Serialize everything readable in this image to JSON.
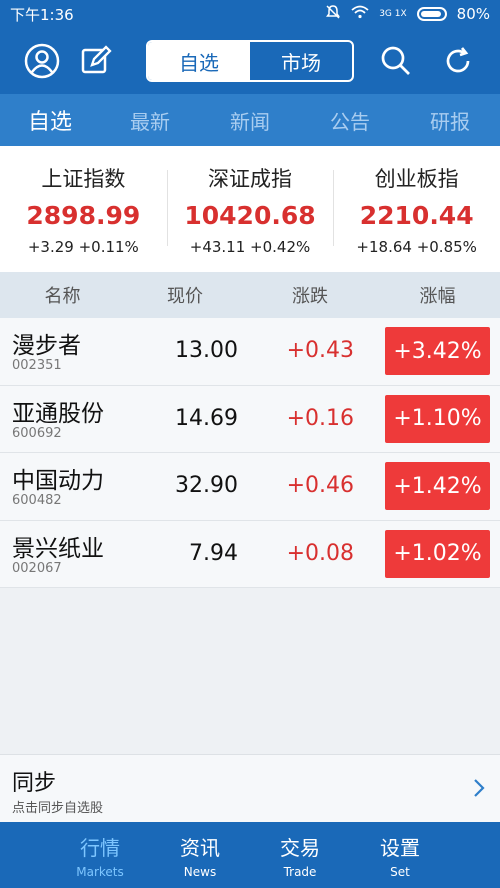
{
  "status_bar": {
    "time": "下午1:36",
    "network": "3G 1X",
    "battery": "80%"
  },
  "app_bar": {
    "segment": [
      "自选",
      "市场"
    ]
  },
  "sub_tabs": [
    "自选",
    "最新",
    "新闻",
    "公告",
    "研报"
  ],
  "indices": [
    {
      "name": "上证指数",
      "value": "2898.99",
      "change": "+3.29 +0.11%"
    },
    {
      "name": "深证成指",
      "value": "10420.68",
      "change": "+43.11 +0.42%"
    },
    {
      "name": "创业板指",
      "value": "2210.44",
      "change": "+18.64 +0.85%"
    }
  ],
  "table": {
    "headers": [
      "名称",
      "现价",
      "涨跌",
      "涨幅"
    ],
    "rows": [
      {
        "name": "漫步者",
        "code": "002351",
        "price": "13.00",
        "change": "+0.43",
        "pct": "+3.42%"
      },
      {
        "name": "亚通股份",
        "code": "600692",
        "price": "14.69",
        "change": "+0.16",
        "pct": "+1.10%"
      },
      {
        "name": "中国动力",
        "code": "600482",
        "price": "32.90",
        "change": "+0.46",
        "pct": "+1.42%"
      },
      {
        "name": "景兴纸业",
        "code": "002067",
        "price": "7.94",
        "change": "+0.08",
        "pct": "+1.02%"
      }
    ]
  },
  "sync": {
    "title": "同步",
    "subtitle": "点击同步自选股"
  },
  "bottom_nav": [
    {
      "zh": "行情",
      "en": "Markets",
      "active": true
    },
    {
      "zh": "资讯",
      "en": "News"
    },
    {
      "zh": "交易",
      "en": "Trade"
    },
    {
      "zh": "设置",
      "en": "Set"
    }
  ],
  "colors": {
    "primary": "#1a69b8",
    "up": "#d8302f",
    "up_badge": "#ee3a3a"
  },
  "icons": [
    "user-icon",
    "edit-icon",
    "search-icon",
    "refresh-icon",
    "bell-muted-icon",
    "wifi-icon",
    "signal-icon",
    "chevron-right-icon"
  ]
}
